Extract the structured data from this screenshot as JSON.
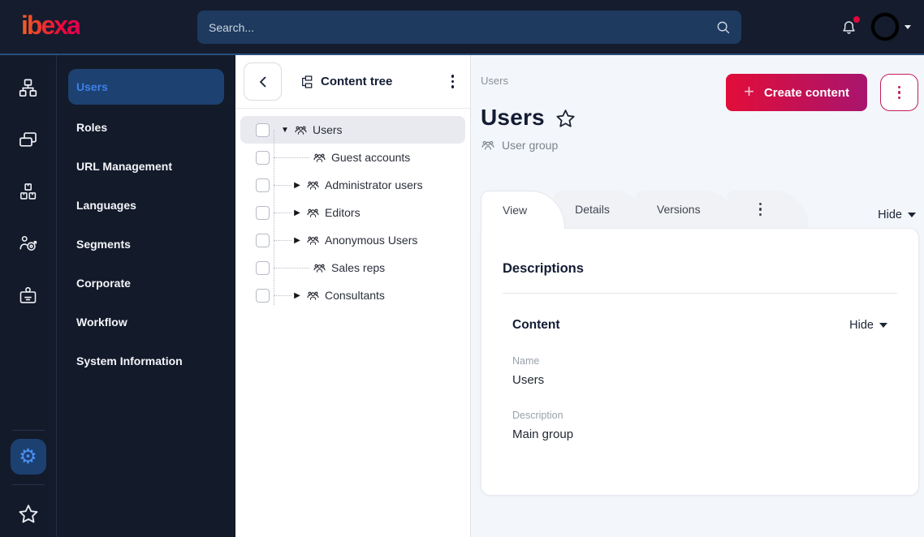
{
  "topbar": {
    "brand": "ibexa",
    "search_placeholder": "Search..."
  },
  "icons": {
    "topbar": [
      "search-icon",
      "bell-icon",
      "avatar",
      "caret-down-icon"
    ],
    "rail": [
      "sitemap-icon",
      "content-icon",
      "products-icon",
      "personalization-icon",
      "badge-icon",
      "gear-icon",
      "star-icon"
    ],
    "tree": [
      "back-chevron-icon",
      "content-tree-icon",
      "kebab-icon",
      "user-group-icon"
    ],
    "main": [
      "plus-icon",
      "kebab-icon",
      "favorite-star-icon",
      "user-group-icon",
      "caret-down-icon"
    ]
  },
  "colors": {
    "topbar_bg": "#141c2e",
    "sidebar_bg": "#131a2a",
    "accent_gradient_start": "#e20d39",
    "accent_gradient_end": "#a8156e",
    "selected_blue_bg": "#1d4170",
    "selected_blue_text": "#3f7fe8",
    "main_bg": "#f3f6fa"
  },
  "sidebar": {
    "items": [
      {
        "label": "Users",
        "selected": true
      },
      {
        "label": "Roles",
        "selected": false
      },
      {
        "label": "URL Management",
        "selected": false
      },
      {
        "label": "Languages",
        "selected": false
      },
      {
        "label": "Segments",
        "selected": false
      },
      {
        "label": "Corporate",
        "selected": false
      },
      {
        "label": "Workflow",
        "selected": false
      },
      {
        "label": "System Information",
        "selected": false
      }
    ]
  },
  "content_tree": {
    "title": "Content tree",
    "items": [
      {
        "label": "Users",
        "caret": "▼",
        "selected": true,
        "depth": 0
      },
      {
        "label": "Guest accounts",
        "caret": "",
        "selected": false,
        "depth": 1
      },
      {
        "label": "Administrator users",
        "caret": "▶",
        "selected": false,
        "depth": 1
      },
      {
        "label": "Editors",
        "caret": "▶",
        "selected": false,
        "depth": 1
      },
      {
        "label": "Anonymous Users",
        "caret": "▶",
        "selected": false,
        "depth": 1
      },
      {
        "label": "Sales reps",
        "caret": "",
        "selected": false,
        "depth": 1
      },
      {
        "label": "Consultants",
        "caret": "▶",
        "selected": false,
        "depth": 1
      }
    ]
  },
  "main": {
    "breadcrumb": "Users",
    "create_button": "Create content",
    "title": "Users",
    "subtitle": "User group",
    "tabs": [
      {
        "label": "View",
        "active": true
      },
      {
        "label": "Details",
        "active": false
      },
      {
        "label": "Versions",
        "active": false
      }
    ],
    "hide_label": "Hide",
    "card": {
      "heading": "Descriptions",
      "section_heading": "Content",
      "section_hide_label": "Hide",
      "fields": [
        {
          "label": "Name",
          "value": "Users"
        },
        {
          "label": "Description",
          "value": "Main group"
        }
      ]
    }
  }
}
